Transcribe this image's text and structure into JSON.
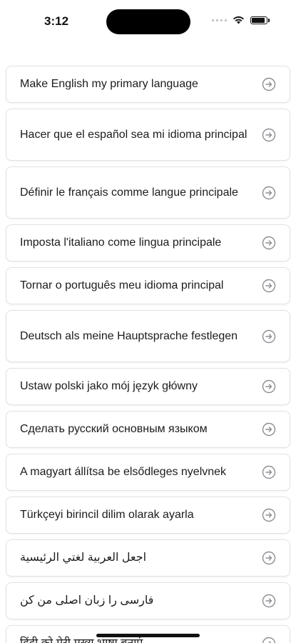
{
  "status_bar": {
    "time": "3:12"
  },
  "icons": {
    "arrow": "arrow-right-circle-icon",
    "wifi": "wifi-icon",
    "battery": "battery-icon"
  },
  "colors": {
    "text": "#1c1c1c",
    "icon": "#8e8e93",
    "border": "#e2e2e4"
  },
  "languages": [
    {
      "label": "Make English my primary language"
    },
    {
      "label": "Hacer que el español sea mi idioma principal"
    },
    {
      "label": "Définir le français comme langue principale"
    },
    {
      "label": "Imposta l'italiano come lingua principale"
    },
    {
      "label": "Tornar o português meu idioma principal"
    },
    {
      "label": "Deutsch als meine Hauptsprache festlegen"
    },
    {
      "label": "Ustaw polski jako mój język główny"
    },
    {
      "label": "Сделать русский основным языком"
    },
    {
      "label": "A magyart állítsa be elsődleges nyelvnek"
    },
    {
      "label": "Türkçeyi birincil dilim olarak ayarla"
    },
    {
      "label": "اجعل العربية لغتي الرئيسية"
    },
    {
      "label": "فارسی را زبان اصلی من کن"
    },
    {
      "label": "हिंदी को मेरी मुख्य भाषा बनाएं"
    }
  ]
}
